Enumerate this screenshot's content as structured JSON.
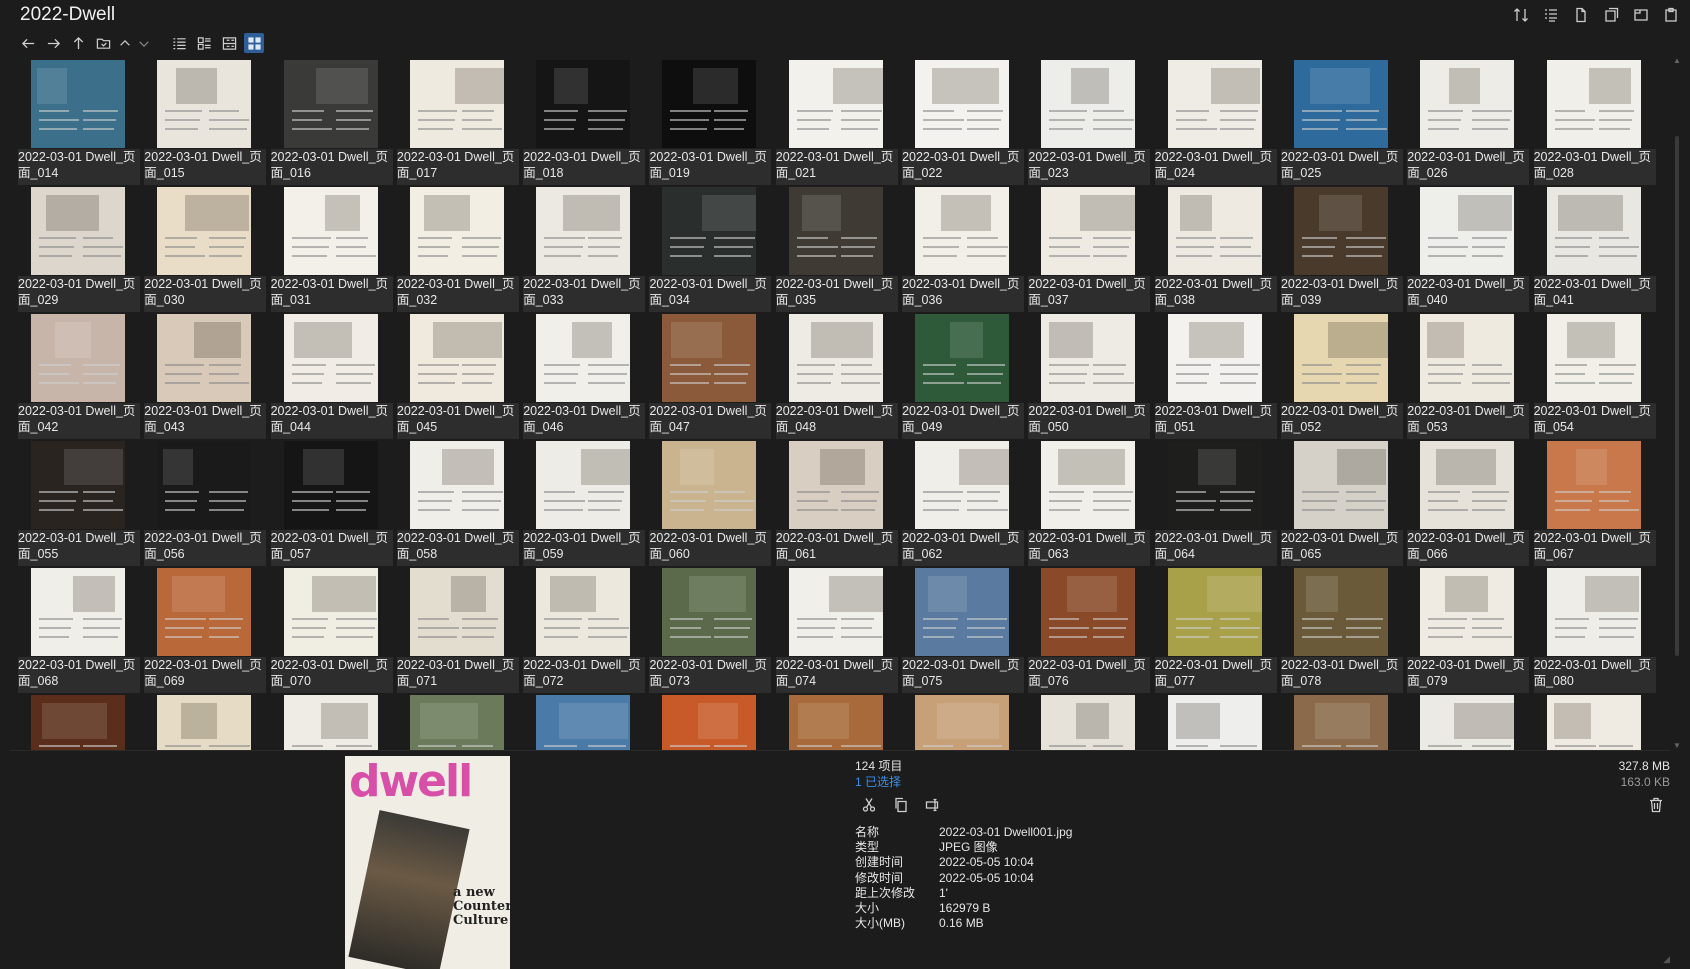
{
  "window": {
    "title": "2022-Dwell"
  },
  "top_toolbar": {
    "icons": [
      "sort-icon",
      "properties-icon",
      "file-icon",
      "new-window-icon",
      "tab-icon",
      "paste-icon"
    ]
  },
  "nav": {
    "icons": [
      "back-arrow-icon",
      "forward-arrow-icon",
      "up-arrow-icon",
      "folder-icon",
      "chevron-up-icon",
      "chevron-down-icon",
      "list-view-icon",
      "details-view-icon",
      "tiles-view-icon",
      "thumbnails-view-icon"
    ]
  },
  "files": [
    "2022-03-01 Dwell_页面_014",
    "2022-03-01 Dwell_页面_015",
    "2022-03-01 Dwell_页面_016",
    "2022-03-01 Dwell_页面_017",
    "2022-03-01 Dwell_页面_018",
    "2022-03-01 Dwell_页面_019",
    "2022-03-01 Dwell_页面_021",
    "2022-03-01 Dwell_页面_022",
    "2022-03-01 Dwell_页面_023",
    "2022-03-01 Dwell_页面_024",
    "2022-03-01 Dwell_页面_025",
    "2022-03-01 Dwell_页面_026",
    "2022-03-01 Dwell_页面_028",
    "2022-03-01 Dwell_页面_029",
    "2022-03-01 Dwell_页面_030",
    "2022-03-01 Dwell_页面_031",
    "2022-03-01 Dwell_页面_032",
    "2022-03-01 Dwell_页面_033",
    "2022-03-01 Dwell_页面_034",
    "2022-03-01 Dwell_页面_035",
    "2022-03-01 Dwell_页面_036",
    "2022-03-01 Dwell_页面_037",
    "2022-03-01 Dwell_页面_038",
    "2022-03-01 Dwell_页面_039",
    "2022-03-01 Dwell_页面_040",
    "2022-03-01 Dwell_页面_041",
    "2022-03-01 Dwell_页面_042",
    "2022-03-01 Dwell_页面_043",
    "2022-03-01 Dwell_页面_044",
    "2022-03-01 Dwell_页面_045",
    "2022-03-01 Dwell_页面_046",
    "2022-03-01 Dwell_页面_047",
    "2022-03-01 Dwell_页面_048",
    "2022-03-01 Dwell_页面_049",
    "2022-03-01 Dwell_页面_050",
    "2022-03-01 Dwell_页面_051",
    "2022-03-01 Dwell_页面_052",
    "2022-03-01 Dwell_页面_053",
    "2022-03-01 Dwell_页面_054",
    "2022-03-01 Dwell_页面_055",
    "2022-03-01 Dwell_页面_056",
    "2022-03-01 Dwell_页面_057",
    "2022-03-01 Dwell_页面_058",
    "2022-03-01 Dwell_页面_059",
    "2022-03-01 Dwell_页面_060",
    "2022-03-01 Dwell_页面_061",
    "2022-03-01 Dwell_页面_062",
    "2022-03-01 Dwell_页面_063",
    "2022-03-01 Dwell_页面_064",
    "2022-03-01 Dwell_页面_065",
    "2022-03-01 Dwell_页面_066",
    "2022-03-01 Dwell_页面_067",
    "2022-03-01 Dwell_页面_068",
    "2022-03-01 Dwell_页面_069",
    "2022-03-01 Dwell_页面_070",
    "2022-03-01 Dwell_页面_071",
    "2022-03-01 Dwell_页面_072",
    "2022-03-01 Dwell_页面_073",
    "2022-03-01 Dwell_页面_074",
    "2022-03-01 Dwell_页面_075",
    "2022-03-01 Dwell_页面_076",
    "2022-03-01 Dwell_页面_077",
    "2022-03-01 Dwell_页面_078",
    "2022-03-01 Dwell_页面_079",
    "2022-03-01 Dwell_页面_080",
    "",
    "",
    "",
    "",
    "",
    "",
    "",
    "",
    "",
    "",
    "",
    "",
    ""
  ],
  "thumb_palettes": [
    [
      "#3b6f8a",
      "#e9e5dc",
      "#3a3a38",
      "#efeae0",
      "#151515",
      "#0e0e0e",
      "#f3f1ec",
      "#f4f2ee",
      "#ededea",
      "#efece5",
      "#2e6a9c",
      "#eeece6",
      "#f1efe9"
    ],
    [
      "#dcd6cd",
      "#e9ddc8",
      "#f3f0ea",
      "#f2eee4",
      "#ece9e2",
      "#2a2f2e",
      "#3f3b34",
      "#f2efe9",
      "#efebe3",
      "#eeeae2",
      "#4a3a2c",
      "#eeeeea",
      "#e9e7e2"
    ],
    [
      "#c8b5aa",
      "#d9c9b8",
      "#f1ede6",
      "#efe9de",
      "#f1efea",
      "#8a5a3a",
      "#eeebe4",
      "#2f5a3a",
      "#eeeae4",
      "#f4f2ee",
      "#e6d7b0",
      "#efeae0",
      "#f1efe8"
    ],
    [
      "#2a2420",
      "#1a1a1a",
      "#151515",
      "#f0eee8",
      "#eeece6",
      "#c9b48f",
      "#d8cfc2",
      "#f0eee9",
      "#f1efe9",
      "#1e1f1c",
      "#d5d0c8",
      "#e6e2da",
      "#c8784a"
    ],
    [
      "#f0eee9",
      "#b9683a",
      "#f0ede3",
      "#e3ddd0",
      "#ece8de",
      "#5a6a4a",
      "#f1efea",
      "#5a7aa0",
      "#8a4a2a",
      "#a9a04a",
      "#6a5a3a",
      "#efebe2",
      "#efede8"
    ],
    [
      "#5a2e1a",
      "#e6dcc6",
      "#efece6",
      "#6a7a5a",
      "#4a7aa8",
      "#c85a2a",
      "#a86a3a",
      "#c8a078",
      "#e6e2da",
      "#eeeeec",
      "#8a6a4a",
      "#eceae4",
      "#f0ebe2"
    ]
  ],
  "status": {
    "item_count": "124 项目",
    "selected_count": "1 已选择",
    "total_size": "327.8 MB",
    "selected_size": "163.0 KB"
  },
  "actions": [
    "cut-icon",
    "copy-icon",
    "rename-icon"
  ],
  "preview": {
    "brand": "dwell",
    "cover_line1": "a new",
    "cover_line2": "Counter",
    "cover_line3": "Culture"
  },
  "properties": [
    {
      "key": "名称",
      "value": "2022-03-01 Dwell001.jpg"
    },
    {
      "key": "类型",
      "value": "JPEG 图像"
    },
    {
      "key": "创建时间",
      "value": "2022-05-05  10:04"
    },
    {
      "key": "修改时间",
      "value": "2022-05-05  10:04"
    },
    {
      "key": "距上次修改",
      "value": "1'"
    },
    {
      "key": "大小",
      "value": "162979 B"
    },
    {
      "key": "大小(MB)",
      "value": "0.16 MB"
    }
  ]
}
